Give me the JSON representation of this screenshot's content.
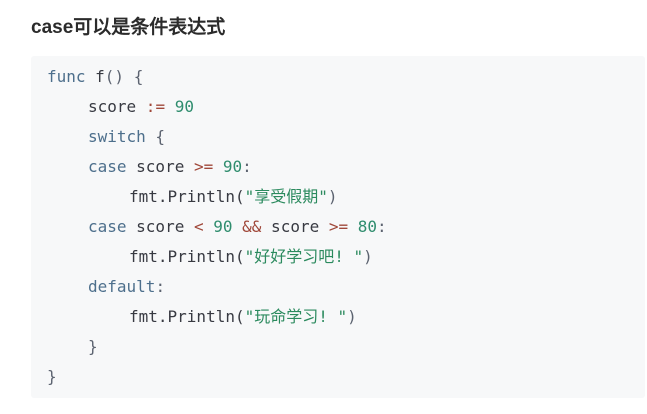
{
  "heading": "case可以是条件表达式",
  "code": {
    "line1": {
      "kw": "func",
      "name": " f",
      "rest": "() {"
    },
    "line2": {
      "ident": "score",
      "op": " := ",
      "num": "90"
    },
    "line3": {
      "kw": "switch",
      "rest": " {"
    },
    "line4": {
      "kw": "case",
      "ident": " score ",
      "op": ">=",
      "sp": " ",
      "num": "90",
      "rest": ":"
    },
    "line5": {
      "ident": "fmt.Println(",
      "str": "\"享受假期\"",
      "rest": ")"
    },
    "line6": {
      "kw": "case",
      "ident": " score ",
      "op1": "<",
      "sp1": " ",
      "num1": "90",
      "sp2": " ",
      "op2": "&&",
      "ident2": " score ",
      "op3": ">=",
      "sp3": " ",
      "num2": "80",
      "rest": ":"
    },
    "line7": {
      "ident": "fmt.Println(",
      "str": "\"好好学习吧! \"",
      "rest": ")"
    },
    "line8": {
      "kw": "default",
      "rest": ":"
    },
    "line9": {
      "ident": "fmt.Println(",
      "str": "\"玩命学习! \"",
      "rest": ")"
    },
    "line10": {
      "rest": "}"
    },
    "line11": {
      "rest": "}"
    }
  },
  "colors": {
    "keyword": "#4d6f8c",
    "number": "#2f8d6e",
    "operator": "#a0483a",
    "string": "#2b8a5e",
    "background": "#f7f8f9"
  }
}
